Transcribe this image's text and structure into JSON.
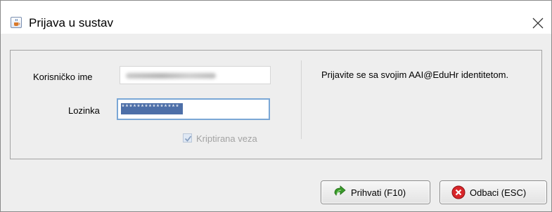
{
  "window": {
    "title": "Prijava u sustav"
  },
  "form": {
    "username_label": "Korisničko ime",
    "password_label": "Lozinka",
    "password_value": "***************",
    "encrypted_label": "Kriptirana veza",
    "encrypted_checked": true,
    "encrypted_enabled": false
  },
  "info_text": "Prijavite se sa svojim AAI@EduHr identitetom.",
  "buttons": {
    "accept_label": "Prihvati (F10)",
    "cancel_label": "Odbaci (ESC)"
  },
  "icons": {
    "title": "java-cup-icon",
    "close": "close-icon",
    "accept": "green-arrow-icon",
    "cancel": "red-x-icon"
  },
  "colors": {
    "selection": "#4d6fa8",
    "focus_border": "#7aa7d6",
    "disabled_text": "#a3a3a3"
  }
}
